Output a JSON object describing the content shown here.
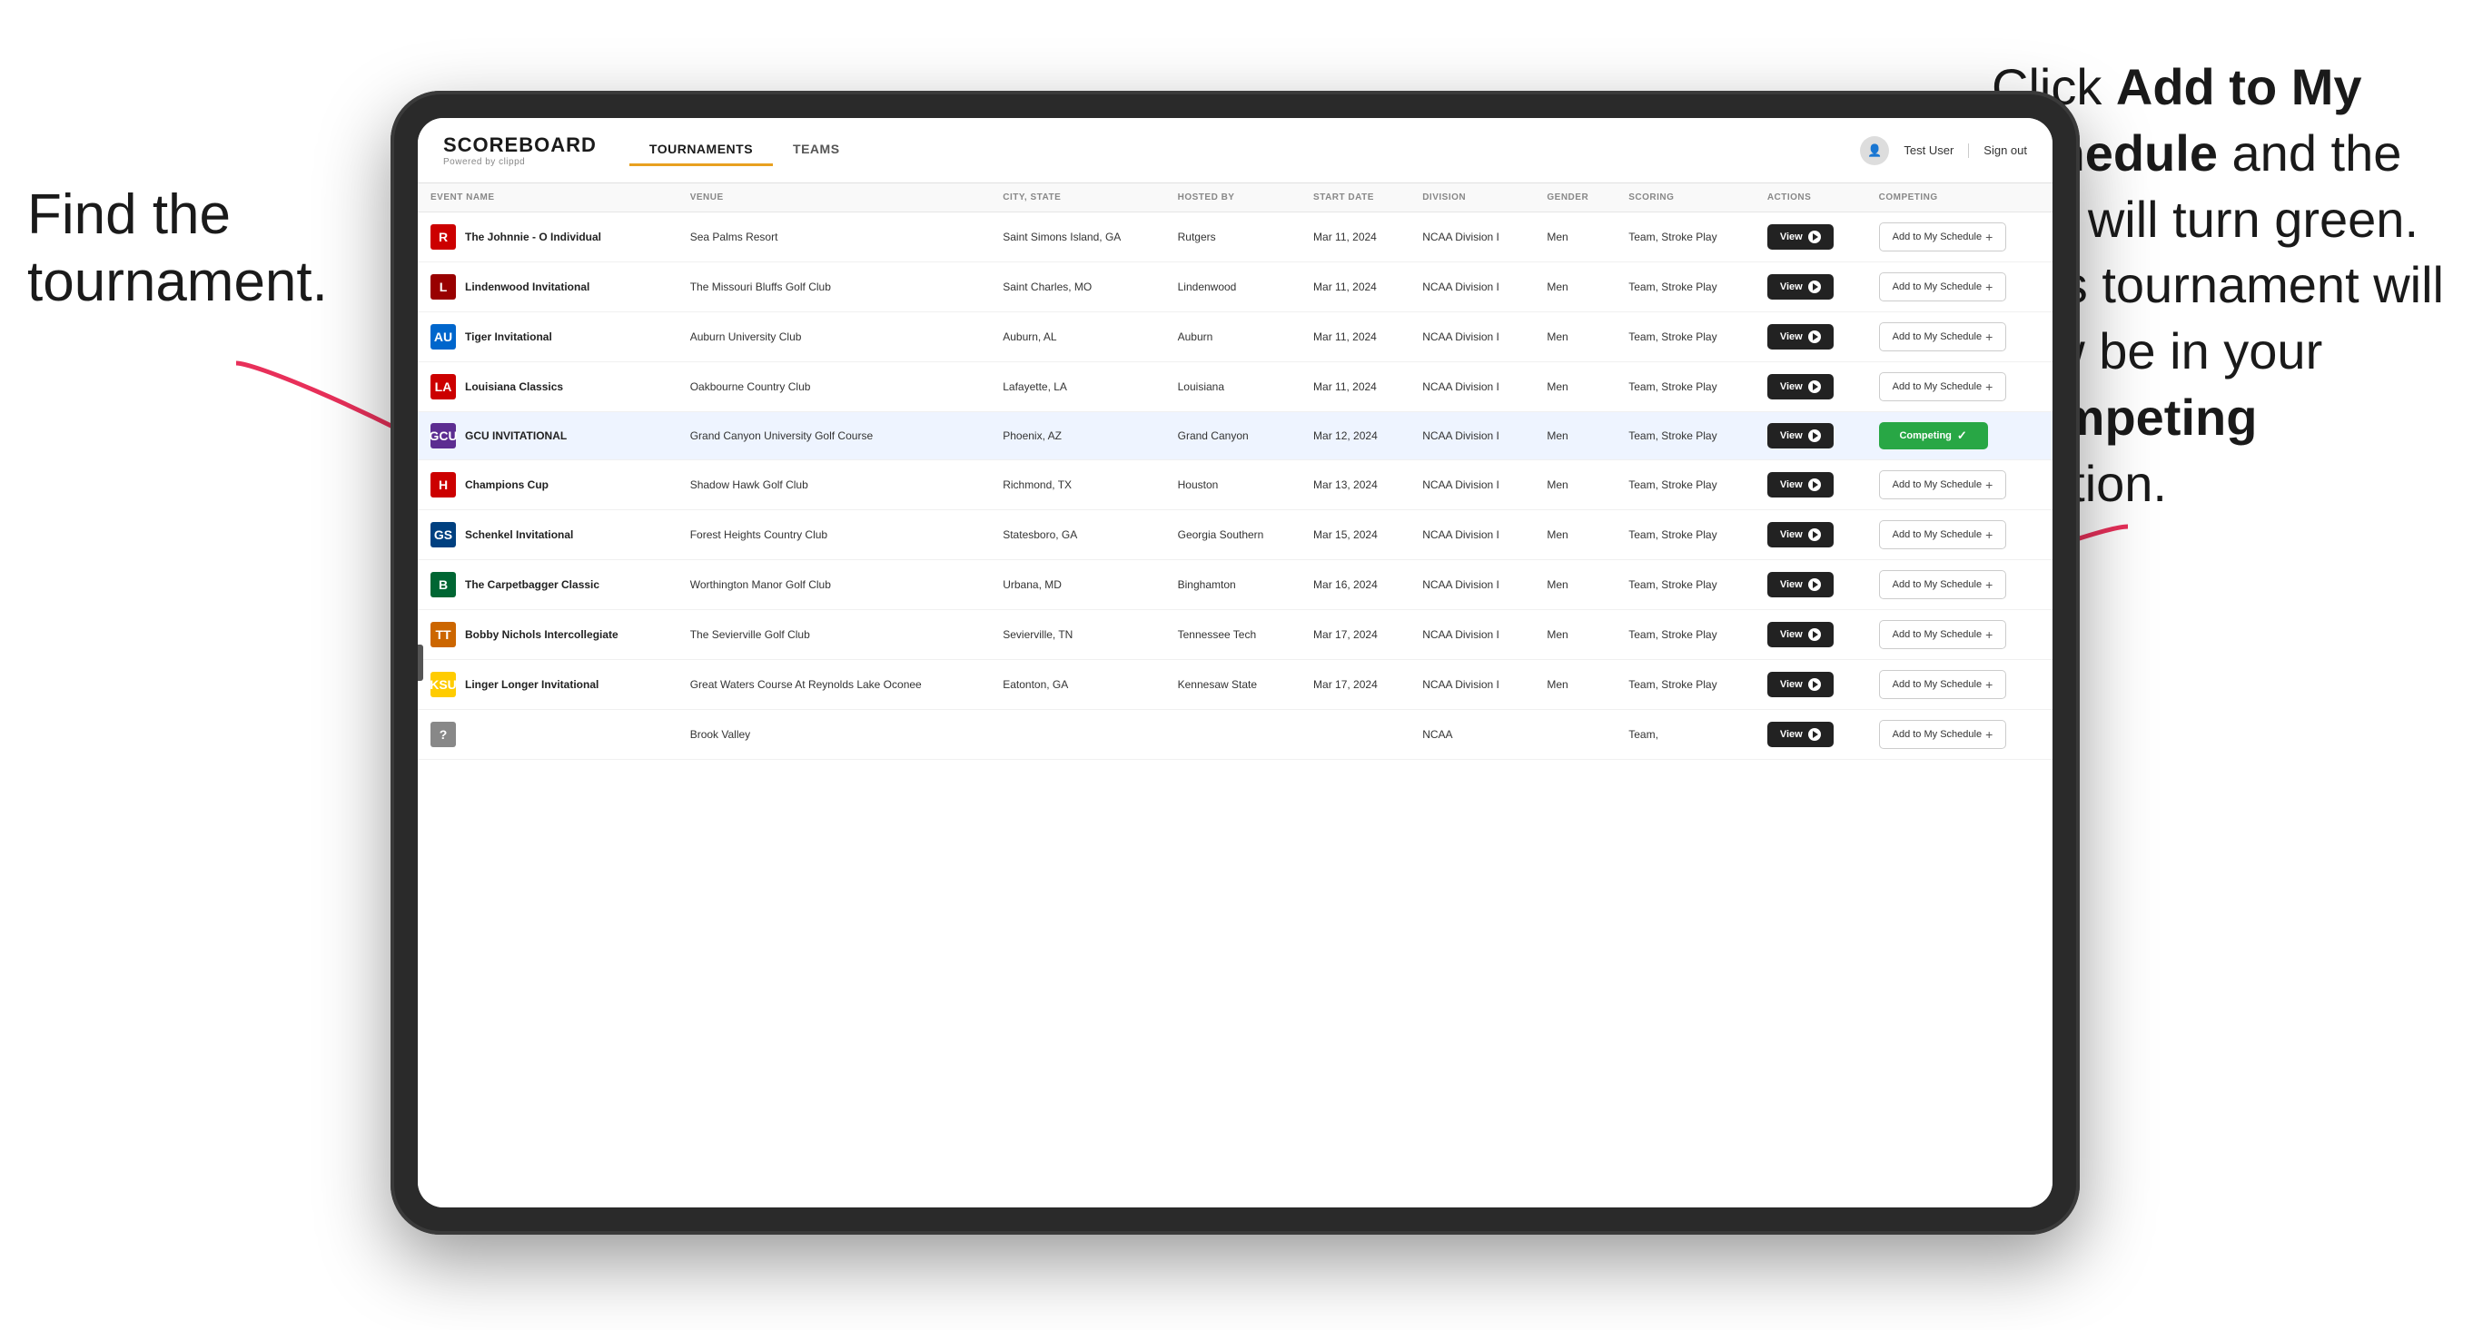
{
  "annotations": {
    "left_title": "Find the tournament.",
    "right_text_1": "Click ",
    "right_bold_1": "Add to My Schedule",
    "right_text_2": " and the box will turn green. This tournament will now be in your ",
    "right_bold_2": "Competing",
    "right_text_3": " section."
  },
  "header": {
    "logo": "SCOREBOARD",
    "logo_sub": "Powered by clippd",
    "nav_tabs": [
      "TOURNAMENTS",
      "TEAMS"
    ],
    "active_tab": "TOURNAMENTS",
    "user_name": "Test User",
    "sign_out": "Sign out"
  },
  "table": {
    "columns": [
      "EVENT NAME",
      "VENUE",
      "CITY, STATE",
      "HOSTED BY",
      "START DATE",
      "DIVISION",
      "GENDER",
      "SCORING",
      "ACTIONS",
      "COMPETING"
    ],
    "rows": [
      {
        "logo_text": "R",
        "logo_color": "#cc0000",
        "event_name": "The Johnnie - O Individual",
        "venue": "Sea Palms Resort",
        "city_state": "Saint Simons Island, GA",
        "hosted_by": "Rutgers",
        "start_date": "Mar 11, 2024",
        "division": "NCAA Division I",
        "gender": "Men",
        "scoring": "Team, Stroke Play",
        "competing_status": "add",
        "competing_label": "Add to My Schedule +"
      },
      {
        "logo_text": "L",
        "logo_color": "#990000",
        "event_name": "Lindenwood Invitational",
        "venue": "The Missouri Bluffs Golf Club",
        "city_state": "Saint Charles, MO",
        "hosted_by": "Lindenwood",
        "start_date": "Mar 11, 2024",
        "division": "NCAA Division I",
        "gender": "Men",
        "scoring": "Team, Stroke Play",
        "competing_status": "add",
        "competing_label": "Add to My Schedule +"
      },
      {
        "logo_text": "AU",
        "logo_color": "#0066cc",
        "event_name": "Tiger Invitational",
        "venue": "Auburn University Club",
        "city_state": "Auburn, AL",
        "hosted_by": "Auburn",
        "start_date": "Mar 11, 2024",
        "division": "NCAA Division I",
        "gender": "Men",
        "scoring": "Team, Stroke Play",
        "competing_status": "add",
        "competing_label": "Add to My Schedule +"
      },
      {
        "logo_text": "LA",
        "logo_color": "#cc0000",
        "event_name": "Louisiana Classics",
        "venue": "Oakbourne Country Club",
        "city_state": "Lafayette, LA",
        "hosted_by": "Louisiana",
        "start_date": "Mar 11, 2024",
        "division": "NCAA Division I",
        "gender": "Men",
        "scoring": "Team, Stroke Play",
        "competing_status": "add",
        "competing_label": "Add to My Schedule +"
      },
      {
        "logo_text": "GCU",
        "logo_color": "#5c2d91",
        "event_name": "GCU INVITATIONAL",
        "venue": "Grand Canyon University Golf Course",
        "city_state": "Phoenix, AZ",
        "hosted_by": "Grand Canyon",
        "start_date": "Mar 12, 2024",
        "division": "NCAA Division I",
        "gender": "Men",
        "scoring": "Team, Stroke Play",
        "competing_status": "competing",
        "competing_label": "Competing ✓"
      },
      {
        "logo_text": "H",
        "logo_color": "#cc0000",
        "event_name": "Champions Cup",
        "venue": "Shadow Hawk Golf Club",
        "city_state": "Richmond, TX",
        "hosted_by": "Houston",
        "start_date": "Mar 13, 2024",
        "division": "NCAA Division I",
        "gender": "Men",
        "scoring": "Team, Stroke Play",
        "competing_status": "add",
        "competing_label": "Add to My Schedule +"
      },
      {
        "logo_text": "GS",
        "logo_color": "#004080",
        "event_name": "Schenkel Invitational",
        "venue": "Forest Heights Country Club",
        "city_state": "Statesboro, GA",
        "hosted_by": "Georgia Southern",
        "start_date": "Mar 15, 2024",
        "division": "NCAA Division I",
        "gender": "Men",
        "scoring": "Team, Stroke Play",
        "competing_status": "add",
        "competing_label": "Add to My Schedule +"
      },
      {
        "logo_text": "B",
        "logo_color": "#006633",
        "event_name": "The Carpetbagger Classic",
        "venue": "Worthington Manor Golf Club",
        "city_state": "Urbana, MD",
        "hosted_by": "Binghamton",
        "start_date": "Mar 16, 2024",
        "division": "NCAA Division I",
        "gender": "Men",
        "scoring": "Team, Stroke Play",
        "competing_status": "add",
        "competing_label": "Add to My Schedule +"
      },
      {
        "logo_text": "TT",
        "logo_color": "#cc6600",
        "event_name": "Bobby Nichols Intercollegiate",
        "venue": "The Sevierville Golf Club",
        "city_state": "Sevierville, TN",
        "hosted_by": "Tennessee Tech",
        "start_date": "Mar 17, 2024",
        "division": "NCAA Division I",
        "gender": "Men",
        "scoring": "Team, Stroke Play",
        "competing_status": "add",
        "competing_label": "Add to My Schedule +"
      },
      {
        "logo_text": "KSU",
        "logo_color": "#ffcc00",
        "event_name": "Linger Longer Invitational",
        "venue": "Great Waters Course At Reynolds Lake Oconee",
        "city_state": "Eatonton, GA",
        "hosted_by": "Kennesaw State",
        "start_date": "Mar 17, 2024",
        "division": "NCAA Division I",
        "gender": "Men",
        "scoring": "Team, Stroke Play",
        "competing_status": "add",
        "competing_label": "Add to My Schedule +"
      },
      {
        "logo_text": "?",
        "logo_color": "#888",
        "event_name": "",
        "venue": "Brook Valley",
        "city_state": "",
        "hosted_by": "",
        "start_date": "",
        "division": "NCAA",
        "gender": "",
        "scoring": "Team,",
        "competing_status": "add",
        "competing_label": "Add to Schedule +"
      }
    ],
    "view_label": "View",
    "add_schedule_label": "Add to My Schedule +",
    "competing_label": "Competing ✓"
  }
}
